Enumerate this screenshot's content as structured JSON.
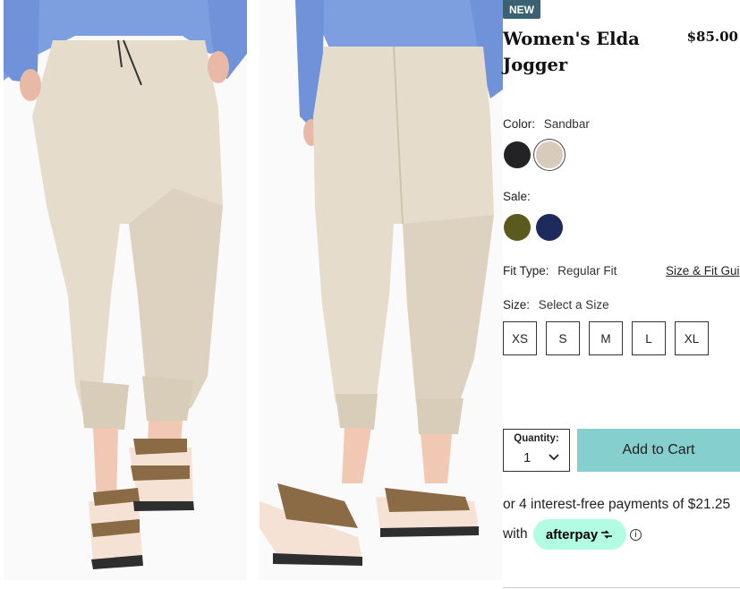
{
  "product": {
    "badge": "NEW",
    "title": "Women's Elda Jogger",
    "price": "$85.00"
  },
  "color": {
    "label": "Color:",
    "selected": "Sandbar",
    "swatches": [
      {
        "name": "black",
        "hex": "#232326"
      },
      {
        "name": "sandbar",
        "hex": "#d9cbbb",
        "selected": true
      }
    ]
  },
  "sale": {
    "label": "Sale:",
    "swatches": [
      {
        "name": "olive",
        "hex": "#5a5a1e"
      },
      {
        "name": "navy",
        "hex": "#1f2a5c"
      }
    ]
  },
  "fit": {
    "label": "Fit Type:",
    "value": "Regular Fit",
    "guide_link": "Size & Fit Gui"
  },
  "size": {
    "label": "Size:",
    "value": "Select a Size",
    "options": [
      "XS",
      "S",
      "M",
      "L",
      "XL"
    ]
  },
  "quantity": {
    "label": "Quantity:",
    "value": "1"
  },
  "cart": {
    "add_label": "Add to Cart"
  },
  "afterpay": {
    "line1": "or 4 interest-free payments of $21.25",
    "with": "with",
    "brand": "afterpay"
  },
  "colors": {
    "badge_bg": "#3a6273",
    "cart_button": "#85cfcf",
    "afterpay_mint": "#b2fce4"
  }
}
